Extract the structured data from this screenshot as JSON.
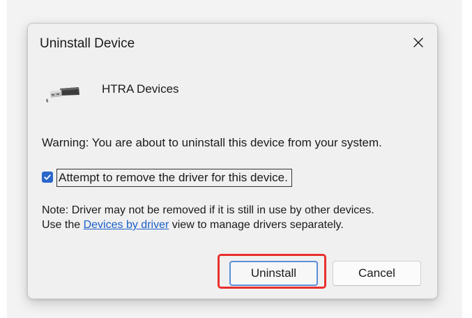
{
  "dialog": {
    "title": "Uninstall Device",
    "device_name": "HTRA Devices",
    "warning": "Warning: You are about to uninstall this device from your system.",
    "checkbox": {
      "label": "Attempt to remove the driver for this device.",
      "checked": true
    },
    "note": {
      "text_before": "Note: Driver may not be removed if it is still in use by other devices. Use the ",
      "link_text": "Devices by driver",
      "text_after": " view to manage drivers separately."
    },
    "buttons": {
      "uninstall": "Uninstall",
      "cancel": "Cancel"
    }
  },
  "icons": {
    "close": "close-icon",
    "device": "usb-cable-icon",
    "checkmark": "checkmark-icon"
  },
  "colors": {
    "accent": "#2b66c9",
    "link": "#1a5fc9",
    "highlight": "#e8302d"
  }
}
